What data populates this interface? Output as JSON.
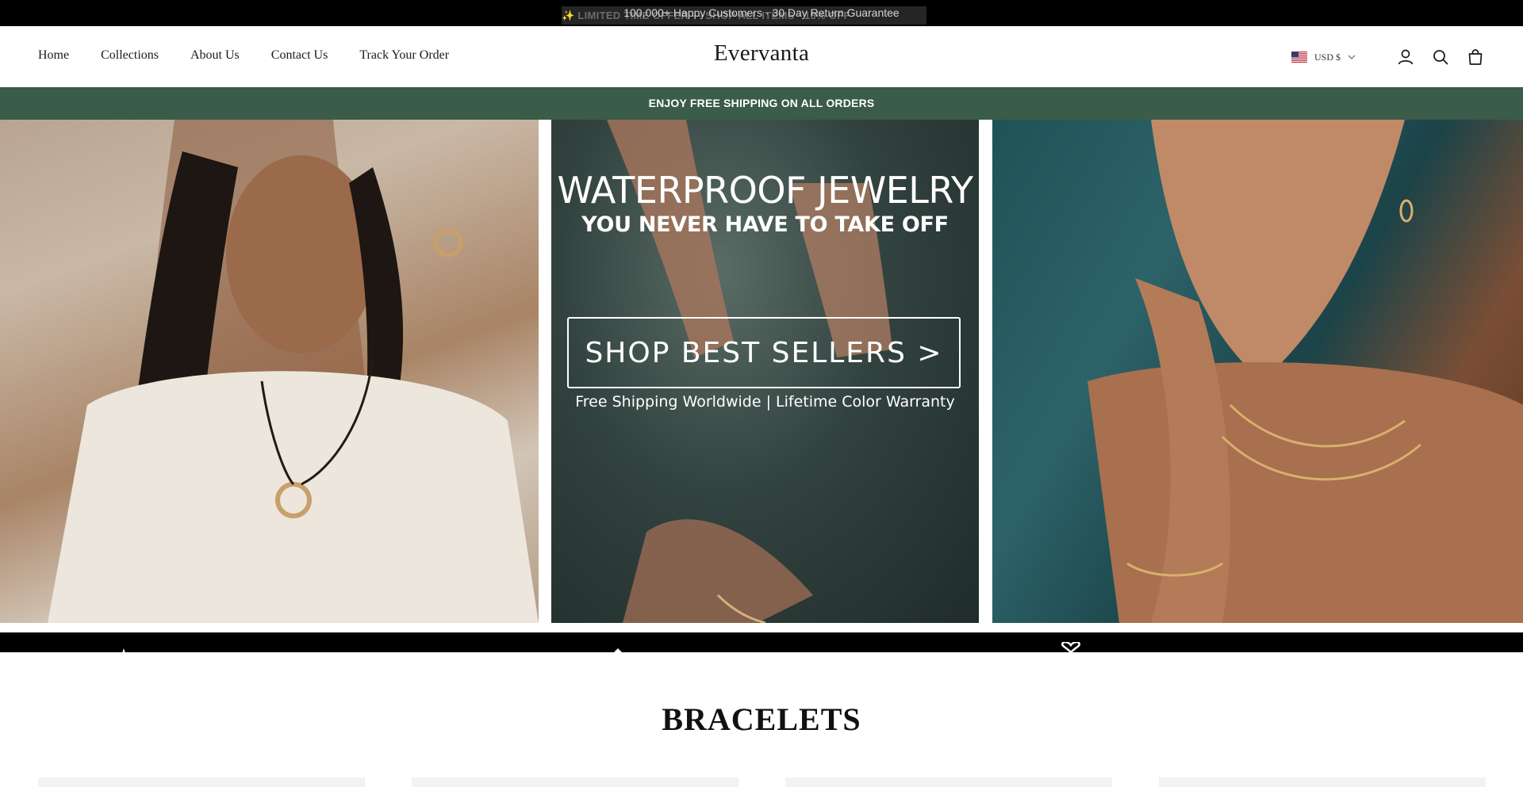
{
  "announcement": {
    "main_text": "100,000+ Happy Customers · 30 Day Return Guarantee",
    "ghost_text": "✨ LIMITED TIME OFFER — SHOP ALL ITEMS · 15% OFF"
  },
  "header": {
    "nav": [
      "Home",
      "Collections",
      "About Us",
      "Contact Us",
      "Track Your Order"
    ],
    "logo": "Evervanta",
    "currency": "USD $",
    "icons": [
      "account-icon",
      "search-icon",
      "cart-icon"
    ]
  },
  "shipping_bar": {
    "text": "ENJOY FREE SHIPPING ON ALL ORDERS",
    "bg_color": "#3a5c49"
  },
  "hero": {
    "headline": "WATERPROOF JEWELRY",
    "subheadline": "YOU NEVER HAVE TO TAKE OFF",
    "cta": "SHOP BEST SELLERS >",
    "tagline": "Free Shipping Worldwide | Lifetime Color Warranty",
    "images": [
      "model-necklace-photo",
      "hands-water-photo",
      "model-chains-photo"
    ]
  },
  "feature_strip": {
    "icons": [
      "star-icon",
      "diamond-icon",
      "heart-icon"
    ]
  },
  "section": {
    "title": "BRACELETS"
  },
  "colors": {
    "brand_green": "#3a5c49",
    "black": "#000000",
    "text": "#1a1a1a"
  }
}
